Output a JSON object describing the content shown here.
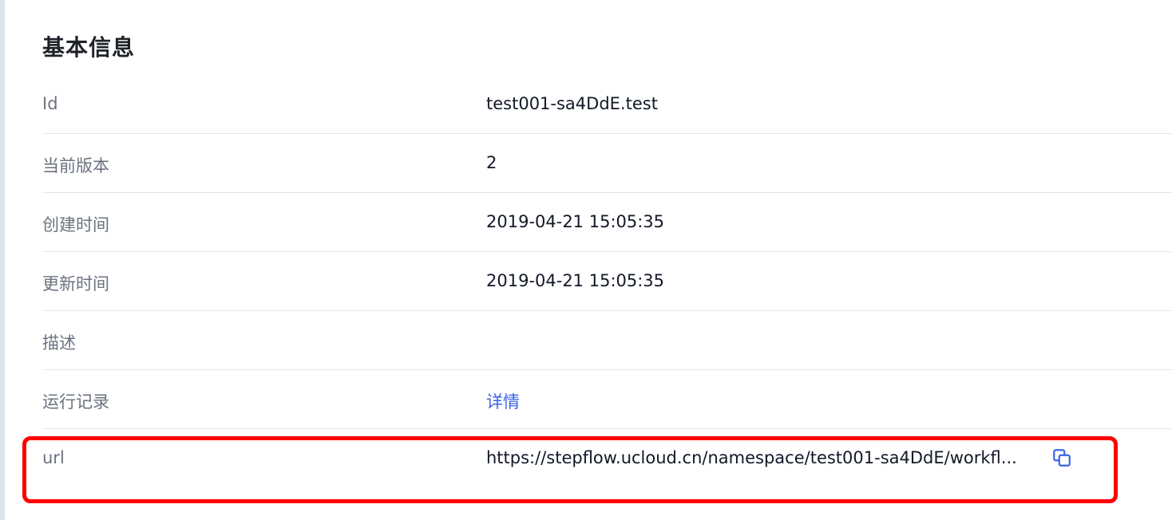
{
  "section": {
    "title": "基本信息"
  },
  "rows": [
    {
      "label": "Id",
      "value": "test001-sa4DdE.test"
    },
    {
      "label": "当前版本",
      "value": "2"
    },
    {
      "label": "创建时间",
      "value": "2019-04-21 15:05:35"
    },
    {
      "label": "更新时间",
      "value": "2019-04-21 15:05:35"
    },
    {
      "label": "描述",
      "value": ""
    },
    {
      "label": "运行记录",
      "link": "详情"
    },
    {
      "label": "url",
      "value": "https://stepflow.ucloud.cn/namespace/test001-sa4DdE/workfl..."
    }
  ],
  "icons": {
    "copy": "copy-icon"
  },
  "colors": {
    "link": "#3b62e8",
    "highlight": "#ff0000"
  }
}
